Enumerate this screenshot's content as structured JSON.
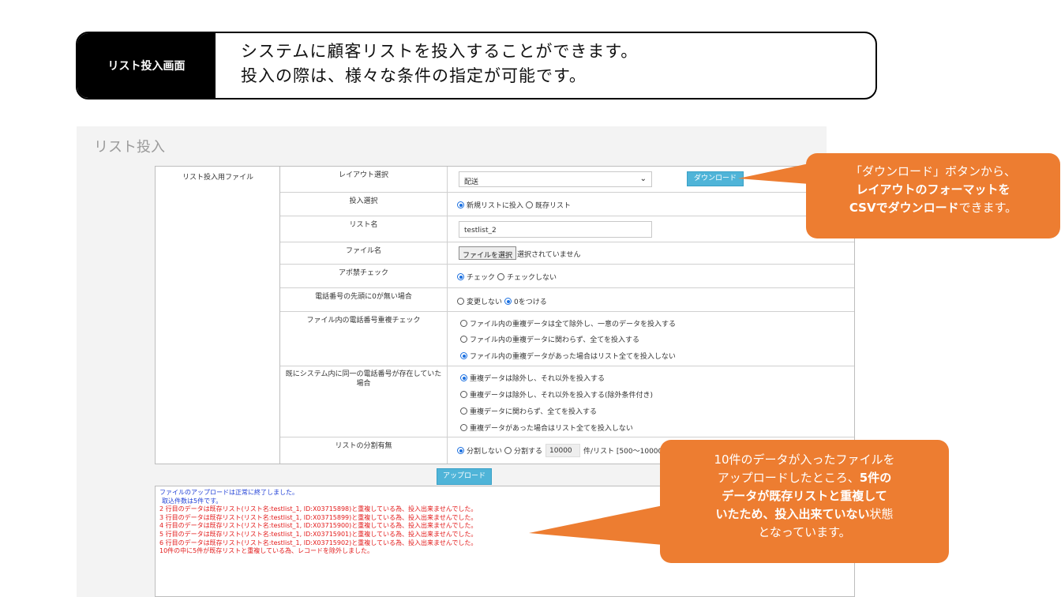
{
  "banner": {
    "tag": "リスト投入画面",
    "line1": "システムに顧客リストを投入することができます。",
    "line2": "投入の際は、様々な条件の指定が可能です。"
  },
  "panel": {
    "title": "リスト投入",
    "file_section_label": "リスト投入用ファイル",
    "layout": {
      "label": "レイアウト選択",
      "selected": "配送",
      "download": "ダウンロード"
    },
    "input_select": {
      "label": "投入選択",
      "opt1": "新規リストに投入",
      "opt2": "既存リスト"
    },
    "list_name": {
      "label": "リスト名",
      "value": "testlist_2"
    },
    "file_name": {
      "label": "ファイル名",
      "button": "ファイルを選択",
      "status": "選択されていません"
    },
    "apo_check": {
      "label": "アポ禁チェック",
      "opt1": "チェック",
      "opt2": "チェックしない"
    },
    "phone_prefix": {
      "label": "電話番号の先頭に0が無い場合",
      "opt1": "変更しない",
      "opt2": "0をつける"
    },
    "dup_in_file": {
      "label": "ファイル内の電話番号重複チェック",
      "opt1": "ファイル内の重複データは全て除外し、一意のデータを投入する",
      "opt2": "ファイル内の重複データに関わらず、全てを投入する",
      "opt3": "ファイル内の重複データがあった場合はリスト全てを投入しない"
    },
    "dup_in_system": {
      "label": "既にシステム内に同一の電話番号が存在していた場合",
      "opt1": "重複データは除外し、それ以外を投入する",
      "opt2": "重複データは除外し、それ以外を投入する(除外条件付き)",
      "opt3": "重複データに関わらず、全てを投入する",
      "opt4": "重複データがあった場合はリスト全てを投入しない"
    },
    "split": {
      "label": "リストの分割有無",
      "opt1": "分割しない",
      "opt2": "分割する",
      "count": "10000",
      "suffix": "件/リスト [500～10000]"
    },
    "upload_button": "アップロード",
    "log": {
      "line1": "ファイルのアップロードは正常に終了しました。",
      "line2": "取込件数は5件です。",
      "errors": [
        "2 行目のデータは既存リスト(リスト名:testlist_1, ID:X03715898)と重複している為、投入出来ませんでした。",
        "3 行目のデータは既存リスト(リスト名:testlist_1, ID:X03715899)と重複している為、投入出来ませんでした。",
        "4 行目のデータは既存リスト(リスト名:testlist_1, ID:X03715900)と重複している為、投入出来ませんでした。",
        "5 行目のデータは既存リスト(リスト名:testlist_1, ID:X03715901)と重複している為、投入出来ませんでした。",
        "6 行目のデータは既存リスト(リスト名:testlist_1, ID:X03715902)と重複している為、投入出来ませんでした。"
      ],
      "summary": "10件の中に5件が既存リストと重複している為、レコードを除外しました。"
    }
  },
  "callout1": {
    "t1": "「ダウンロード」ボタンから、",
    "t2": "レイアウトのフォーマットを",
    "t3": "CSVでダウンロード",
    "t4": "できます。"
  },
  "callout2": {
    "t1": "10件のデータが入ったファイルを",
    "t2": "アップロードしたところ、",
    "t3": "5件の",
    "t4": "データが既存リストと重複して",
    "t5": "いたため、投入出来ていない",
    "t6": "状態",
    "t7": "となっています。"
  },
  "colors": {
    "accent": "#ed7d31",
    "button": "#4fb4d8",
    "error": "#e31b1b",
    "info": "#1f3fd6"
  }
}
